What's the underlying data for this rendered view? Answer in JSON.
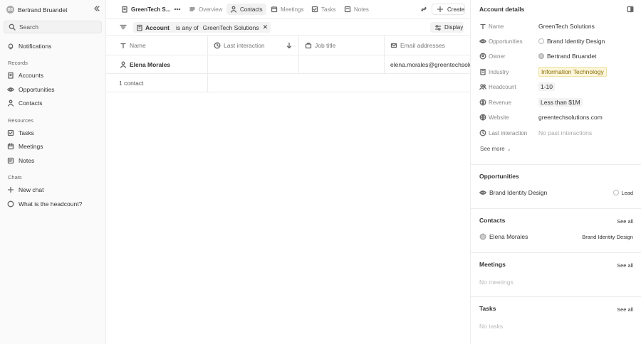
{
  "sidebar": {
    "user": {
      "initials": "BB",
      "name": "Bertrand Bruandet"
    },
    "search_label": "Search",
    "notifications_label": "Notifications",
    "records_title": "Records",
    "records": [
      {
        "label": "Accounts",
        "icon": "building-icon"
      },
      {
        "label": "Opportunities",
        "icon": "eye-icon"
      },
      {
        "label": "Contacts",
        "icon": "person-icon"
      }
    ],
    "resources_title": "Resources",
    "resources": [
      {
        "label": "Tasks",
        "icon": "checkbox-icon"
      },
      {
        "label": "Meetings",
        "icon": "calendar-icon"
      },
      {
        "label": "Notes",
        "icon": "note-icon"
      }
    ],
    "chats_title": "Chats",
    "chats": [
      {
        "label": "New chat",
        "icon": "plus-icon"
      },
      {
        "label": "What is the headcount?",
        "icon": "chat-icon"
      }
    ]
  },
  "topbar": {
    "view_title": "GreenTech S...",
    "tabs": [
      {
        "label": "Overview",
        "active": false
      },
      {
        "label": "Contacts",
        "active": true
      },
      {
        "label": "Meetings",
        "active": false
      },
      {
        "label": "Tasks",
        "active": false
      },
      {
        "label": "Notes",
        "active": false
      }
    ],
    "create_label": "Create"
  },
  "filter": {
    "field": "Account",
    "operator": "is any of",
    "value": "GreenTech Solutions",
    "display_label": "Display"
  },
  "table": {
    "columns": [
      "Name",
      "Last interaction",
      "Job title",
      "Email addresses"
    ],
    "rows": [
      {
        "name": "Elena Morales",
        "last_interaction": "",
        "job_title": "",
        "email": "elena.morales@greentechsolutions.com"
      }
    ],
    "footer_count": "1 contact"
  },
  "panel": {
    "title": "Account details",
    "details": [
      {
        "label": "Name",
        "value": "GreenTech Solutions",
        "icon": "text-icon",
        "style": "plain"
      },
      {
        "label": "Opportunities",
        "value": "Brand Identity Design",
        "icon": "eye-icon",
        "style": "dot"
      },
      {
        "label": "Owner",
        "value": "Bertrand Bruandet",
        "icon": "person-circle-icon",
        "style": "avatar"
      },
      {
        "label": "Industry",
        "value": "Information Technology",
        "icon": "building-icon",
        "style": "tag"
      },
      {
        "label": "Headcount",
        "value": "1-10",
        "icon": "people-icon",
        "style": "plain-tag"
      },
      {
        "label": "Revenue",
        "value": "Less than $1M",
        "icon": "dollar-icon",
        "style": "plain"
      },
      {
        "label": "Website",
        "value": "greentechsolutions.com",
        "icon": "globe-icon",
        "style": "plain"
      },
      {
        "label": "Last interaction",
        "value": "No past interactions",
        "icon": "clock-icon",
        "style": "muted"
      }
    ],
    "see_more_label": "See more",
    "opportunities": {
      "title": "Opportunities",
      "item": "Brand Identity Design",
      "stage": "Lead"
    },
    "contacts": {
      "title": "Contacts",
      "see_all": "See all",
      "item": "Elena Morales",
      "related": "Brand Identity Design"
    },
    "meetings": {
      "title": "Meetings",
      "see_all": "See all",
      "empty": "No meetings"
    },
    "tasks": {
      "title": "Tasks",
      "see_all": "See all",
      "empty": "No tasks"
    }
  }
}
